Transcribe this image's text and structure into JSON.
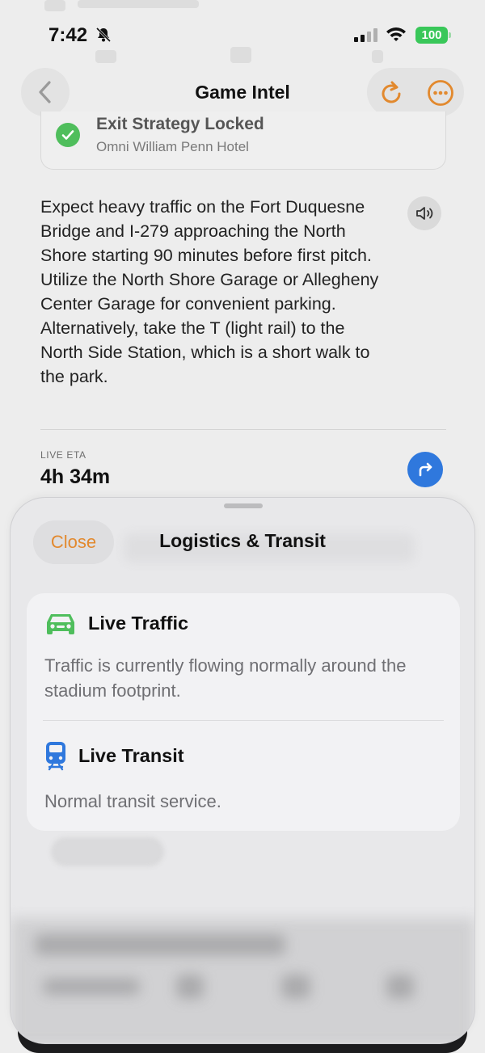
{
  "status_bar": {
    "time": "7:42",
    "battery": "100"
  },
  "nav": {
    "title": "Game Intel"
  },
  "exit_card": {
    "title": "Exit Strategy Locked",
    "subtitle": "Omni William Penn Hotel"
  },
  "intel": {
    "text": "Expect heavy traffic on the Fort Duquesne Bridge and I-279 approaching the North Shore starting 90 minutes before first pitch. Utilize the North Shore Garage or Allegheny Center Garage for convenient parking. Alternatively, take the T (light rail) to the North Side Station, which is a short walk to the park."
  },
  "eta": {
    "label": "LIVE ETA",
    "value": "4h 34m"
  },
  "sheet": {
    "close_label": "Close",
    "title": "Logistics & Transit",
    "items": [
      {
        "icon": "car-icon",
        "label": "Live Traffic",
        "description": "Traffic is currently flowing normally around the stadium footprint.",
        "color": "#4fbe5c"
      },
      {
        "icon": "train-icon",
        "label": "Live Transit",
        "description": "Normal transit service.",
        "color": "#2f78dd"
      }
    ]
  },
  "colors": {
    "accent": "#e2892e",
    "success": "#4fbe5c",
    "primary_blue": "#2f78dd"
  }
}
